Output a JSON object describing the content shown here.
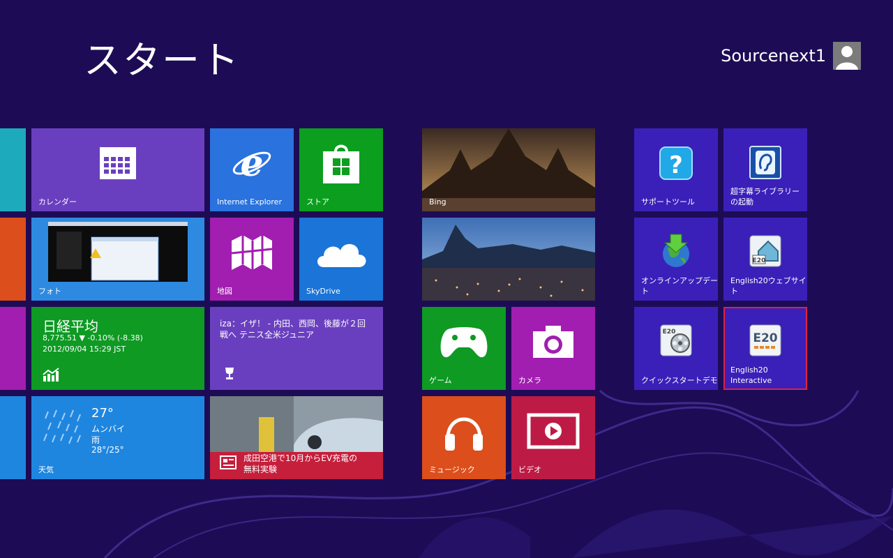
{
  "screen": {
    "title": "スタート",
    "user_name": "Sourcenext1"
  },
  "tiles": {
    "calendar": {
      "label": "カレンダー",
      "icon": "calendar-icon",
      "color": "#6a3fbf"
    },
    "ie": {
      "label": "Internet Explorer",
      "icon": "ie-icon",
      "color": "#2a72de"
    },
    "store": {
      "label": "ストア",
      "icon": "store-icon",
      "color": "#0c9e1f"
    },
    "bing": {
      "label": "Bing",
      "icon": "bing-photo"
    },
    "photo": {
      "label": "フォト",
      "icon": "photo-thumbnail"
    },
    "maps": {
      "label": "地図",
      "icon": "map-icon",
      "color": "#a11eb0"
    },
    "skydrive": {
      "label": "SkyDrive",
      "icon": "cloud-icon",
      "color": "#1b74d8"
    },
    "finance": {
      "title": "日経平均",
      "line1": "8,775.51  ▼ -0.10% (-8.38)",
      "line2": "2012/09/04 15:29 JST",
      "icon": "chart-icon",
      "color": "#0e9a23"
    },
    "sports": {
      "text": "iza：イザ！ - 内田、西岡、後藤が２回戦へ テニス全米ジュニア",
      "icon": "trophy-icon",
      "color": "#6a3fbf"
    },
    "weather": {
      "label": "天気",
      "temp": "27°",
      "city": "ムンバイ",
      "cond": "雨",
      "range": "28°/25°",
      "color": "#1f86e0"
    },
    "news": {
      "text_line1": "成田空港で10月からEV充電の",
      "text_line2": "無料実験",
      "icon": "news-icon",
      "color": "#c51f3c"
    },
    "games": {
      "label": "ゲーム",
      "icon": "gamepad-icon",
      "color": "#0e9a23"
    },
    "camera": {
      "label": "カメラ",
      "icon": "camera-icon",
      "color": "#a11eb0"
    },
    "music": {
      "label": "ミュージック",
      "icon": "headphones-icon",
      "color": "#dc4e1b"
    },
    "video": {
      "label": "ビデオ",
      "icon": "video-icon",
      "color": "#bd1b45"
    },
    "support": {
      "label": "サポートツール",
      "icon": "help-icon",
      "color": "#3a20b9"
    },
    "subtitle_lib": {
      "label_line1": "超字幕ライブラリー",
      "label_line2": "の起動",
      "icon": "subtitle-icon",
      "color": "#3a20b9"
    },
    "online_update": {
      "label_line1": "オンラインアップデー",
      "label_line2": "ト",
      "icon": "update-icon",
      "color": "#3a20b9"
    },
    "english_web": {
      "label_line1": "English20ウェブサイ",
      "label_line2": "ト",
      "icon": "web-icon",
      "color": "#3a20b9"
    },
    "quickstart": {
      "label": "クイックスタートデモ",
      "icon": "film-icon",
      "color": "#3a20b9"
    },
    "english_interactive": {
      "label_line1": "English20",
      "label_line2": "Interactive",
      "icon": "e20-icon",
      "color": "#3a20b9"
    }
  }
}
